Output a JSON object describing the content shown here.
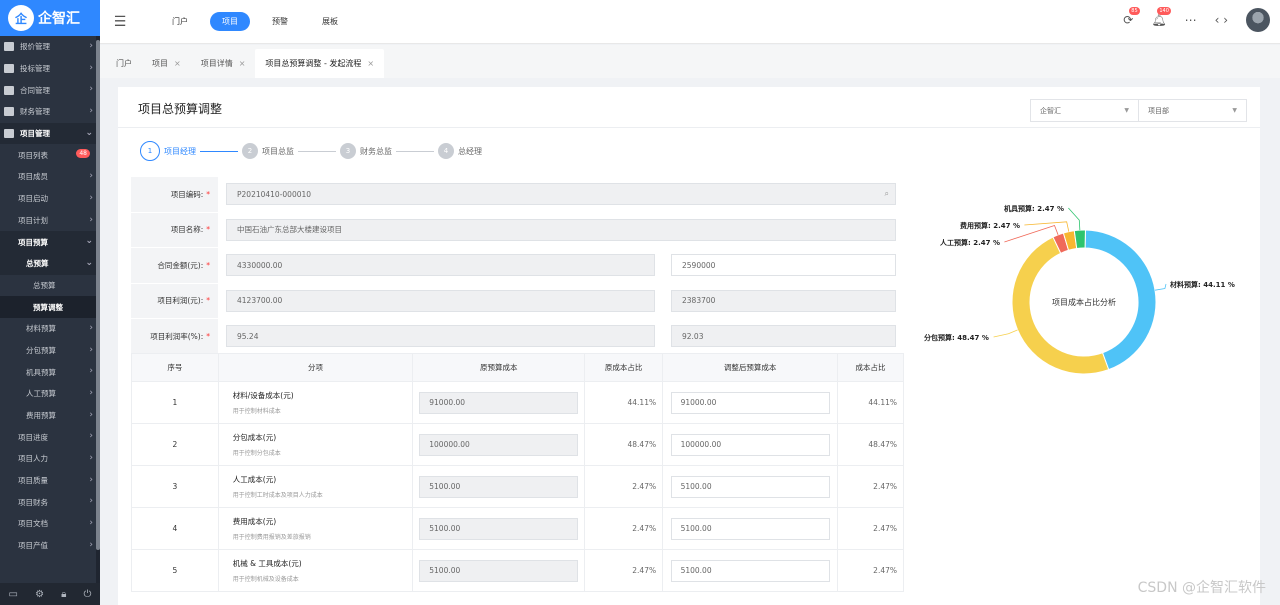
{
  "brand": {
    "mark": "企",
    "name": "企智汇"
  },
  "sidebar": {
    "items": [
      {
        "label": "报价管理",
        "level": "top",
        "chevron": "›"
      },
      {
        "label": "投标管理",
        "level": "top",
        "chevron": "›"
      },
      {
        "label": "合同管理",
        "level": "top",
        "chevron": "›"
      },
      {
        "label": "财务管理",
        "level": "top",
        "chevron": "›"
      },
      {
        "label": "项目管理",
        "level": "top",
        "chevron": "⌄",
        "active": true
      },
      {
        "label": "项目列表",
        "level": "sub",
        "badge": "48"
      },
      {
        "label": "项目成员",
        "level": "sub",
        "chevron": "›"
      },
      {
        "label": "项目启动",
        "level": "sub",
        "chevron": "›"
      },
      {
        "label": "项目计划",
        "level": "sub",
        "chevron": "›"
      },
      {
        "label": "项目预算",
        "level": "sub",
        "chevron": "⌄",
        "active": true
      },
      {
        "label": "总预算",
        "level": "sub2",
        "chevron": "⌄",
        "active": true
      },
      {
        "label": "总预算",
        "level": "sub3"
      },
      {
        "label": "预算调整",
        "level": "sub3"
      },
      {
        "label": "材料预算",
        "level": "sub2",
        "chevron": "›"
      },
      {
        "label": "分包预算",
        "level": "sub2",
        "chevron": "›"
      },
      {
        "label": "机具预算",
        "level": "sub2",
        "chevron": "›"
      },
      {
        "label": "人工预算",
        "level": "sub2",
        "chevron": "›"
      },
      {
        "label": "费用预算",
        "level": "sub2",
        "chevron": "›"
      },
      {
        "label": "项目进度",
        "level": "sub",
        "chevron": "›"
      },
      {
        "label": "项目人力",
        "level": "sub",
        "chevron": "›"
      },
      {
        "label": "项目质量",
        "level": "sub",
        "chevron": "›"
      },
      {
        "label": "项目财务",
        "level": "sub",
        "chevron": "›"
      },
      {
        "label": "项目文档",
        "level": "sub",
        "chevron": "›"
      },
      {
        "label": "项目产值",
        "level": "sub",
        "chevron": "›"
      }
    ],
    "footer_icons": [
      "monitor-icon",
      "gear-icon",
      "lock-icon",
      "power-icon"
    ]
  },
  "header": {
    "nav": [
      {
        "label": "门户",
        "active": false
      },
      {
        "label": "项目",
        "active": true
      },
      {
        "label": "预警",
        "active": false
      },
      {
        "label": "展板",
        "active": false
      }
    ],
    "sync_badge": "85",
    "bell_badge": "140"
  },
  "tabs": [
    {
      "label": "门户",
      "closable": false,
      "active": false
    },
    {
      "label": "项目",
      "closable": true,
      "active": false
    },
    {
      "label": "项目详情",
      "closable": true,
      "active": false
    },
    {
      "label": "项目总预算调整 - 发起流程",
      "closable": true,
      "active": true
    }
  ],
  "page": {
    "title": "项目总预算调整",
    "company_select": "企智汇",
    "dept_select": "项目部"
  },
  "steps": [
    {
      "num": "1",
      "label": "项目经理",
      "active": true
    },
    {
      "num": "2",
      "label": "项目总监",
      "active": false
    },
    {
      "num": "3",
      "label": "财务总监",
      "active": false
    },
    {
      "num": "4",
      "label": "总经理",
      "active": false
    }
  ],
  "form": {
    "code_label": "项目编码:",
    "code_value": "P20210410-000010",
    "name_label": "项目名称:",
    "name_value": "中国石油广东总部大楼建设项目",
    "contract_label": "合同金额(元):",
    "contract_value": "4330000.00",
    "contract_adjusted": "2590000",
    "profit_label": "项目利润(元):",
    "profit_value": "4123700.00",
    "profit_adjusted": "2383700",
    "rate_label": "项目利润率(%):",
    "rate_value": "95.24",
    "rate_adjusted": "92.03"
  },
  "table": {
    "headers": [
      "序号",
      "分项",
      "原预算成本",
      "原成本占比",
      "调整后预算成本",
      "成本占比"
    ],
    "rows": [
      {
        "no": "1",
        "title": "材料/设备成本(元)",
        "desc": "用于控制材料成本",
        "orig": "91000.00",
        "orig_pct": "44.11%",
        "adj": "91000.00",
        "pct": "44.11%"
      },
      {
        "no": "2",
        "title": "分包成本(元)",
        "desc": "用于控制分包成本",
        "orig": "100000.00",
        "orig_pct": "48.47%",
        "adj": "100000.00",
        "pct": "48.47%"
      },
      {
        "no": "3",
        "title": "人工成本(元)",
        "desc": "用于控制工时成本及项目人力成本",
        "orig": "5100.00",
        "orig_pct": "2.47%",
        "adj": "5100.00",
        "pct": "2.47%"
      },
      {
        "no": "4",
        "title": "费用成本(元)",
        "desc": "用于控制费用报销及差旅报销",
        "orig": "5100.00",
        "orig_pct": "2.47%",
        "adj": "5100.00",
        "pct": "2.47%"
      },
      {
        "no": "5",
        "title": "机械 & 工具成本(元)",
        "desc": "用于控制机械及设备成本",
        "orig": "5100.00",
        "orig_pct": "2.47%",
        "adj": "5100.00",
        "pct": "2.47%"
      }
    ]
  },
  "chart_data": {
    "type": "pie",
    "title": "项目成本占比分析",
    "donut": true,
    "slices": [
      {
        "label": "材料预算",
        "value": 44.11,
        "text": "材料预算: 44.11 %",
        "color": "#4fc3f7"
      },
      {
        "label": "分包预算",
        "value": 48.47,
        "text": "分包预算: 48.47 %",
        "color": "#f6d04d"
      },
      {
        "label": "人工预算",
        "value": 2.47,
        "text": "人工预算: 2.47 %",
        "color": "#f06a5a"
      },
      {
        "label": "费用预算",
        "value": 2.47,
        "text": "费用预算: 2.47 %",
        "color": "#f7b731"
      },
      {
        "label": "机具预算",
        "value": 2.47,
        "text": "机具预算: 2.47 %",
        "color": "#2ec46e"
      }
    ]
  },
  "watermark": "CSDN @企智汇软件"
}
